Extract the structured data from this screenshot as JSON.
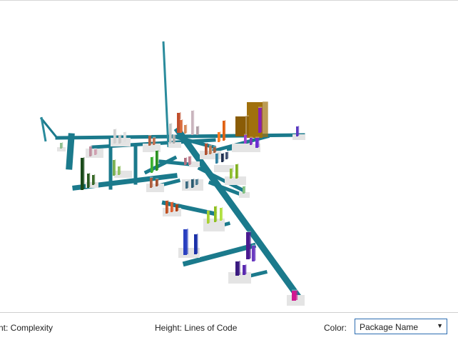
{
  "viewport": {
    "road_color": "#1b7a8c",
    "ground_color": "#e4e4e4"
  },
  "footer": {
    "footprint_label": "nt: Complexity",
    "height_label": "Height: Lines of Code",
    "color_label": "Color:",
    "color_select": {
      "value": "Package Name",
      "arrow_glyph": "▼"
    }
  }
}
